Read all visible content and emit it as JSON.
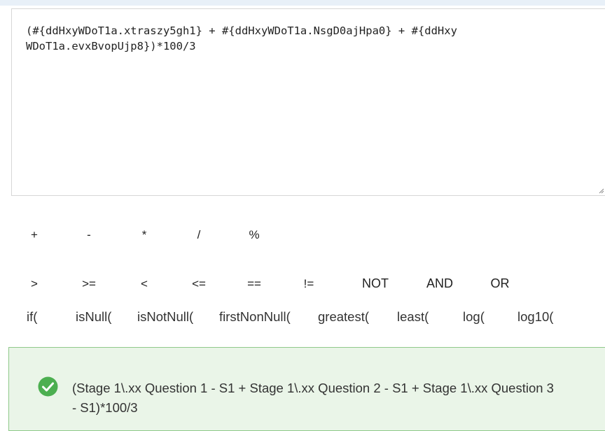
{
  "editor": {
    "formula": "(#{ddHxyWDoT1a.xtraszy5gh1} + #{ddHxyWDoT1a.NsgD0ajHpa0} + #{ddHxyWDoT1a.evxBvopUjp8})*100/3"
  },
  "operators_row1": [
    "+",
    "-",
    "*",
    "/",
    "%"
  ],
  "operators_row2": [
    ">",
    ">=",
    "<",
    "<=",
    "==",
    "!=",
    "NOT",
    "AND",
    "OR"
  ],
  "functions": [
    "if(",
    "isNull(",
    "isNotNull(",
    "firstNonNull(",
    "greatest(",
    "least(",
    "log(",
    "log10("
  ],
  "result": {
    "status": "valid",
    "text": "(Stage 1\\.xx Question 1 - S1 + Stage 1\\.xx Question 2 - S1 + Stage 1\\.xx Question 3 - S1)*100/3",
    "accent_color": "#4caf50"
  }
}
